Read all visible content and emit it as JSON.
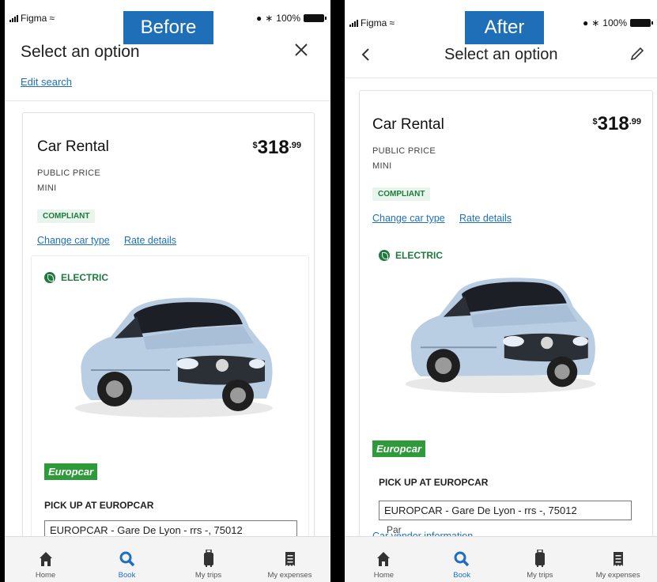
{
  "before": {
    "tag": "Before",
    "status": {
      "carrier": "Figma",
      "battery": "100%"
    },
    "header": {
      "title": "Select an option",
      "edit_link": "Edit search"
    },
    "card": {
      "title": "Car Rental",
      "price_symbol": "$",
      "price_main": "318",
      "price_cents": ".99",
      "public_price": "PUBLIC PRICE",
      "car_class": "MINI",
      "badge": "COMPLIANT",
      "change_car": "Change car type",
      "rate_details": "Rate details",
      "electric": "ELECTRIC",
      "vendor": "Europcar",
      "pickup_label": "PICK UP AT EUROPCAR",
      "address": "EUROPCAR - Gare De Lyon - rrs -, 75012"
    },
    "tabs": [
      {
        "label": "Home"
      },
      {
        "label": "Book"
      },
      {
        "label": "My trips"
      },
      {
        "label": "My expenses"
      }
    ]
  },
  "after": {
    "tag": "After",
    "status": {
      "carrier": "Figma",
      "battery": "100%"
    },
    "header": {
      "title": "Select an option"
    },
    "card": {
      "title": "Car Rental",
      "price_symbol": "$",
      "price_main": "318",
      "price_cents": ".99",
      "public_price": "PUBLIC PRICE",
      "car_class": "MINI",
      "badge": "COMPLIANT",
      "change_car": "Change car type",
      "rate_details": "Rate details",
      "electric": "ELECTRIC",
      "vendor": "Europcar",
      "pickup_label": "PICK UP AT EUROPCAR",
      "address": "EUROPCAR - Gare De Lyon - rrs -, 75012",
      "par": "Par",
      "vendor_link": "Car vendor information"
    },
    "tabs": [
      {
        "label": "Home"
      },
      {
        "label": "Book"
      },
      {
        "label": "My trips"
      },
      {
        "label": "My expenses"
      }
    ]
  },
  "colors": {
    "accent": "#1f6fc1",
    "tag_bg": "#1f6fb8",
    "compliant": "#1e7a3d",
    "europcar": "#2f9a39"
  }
}
